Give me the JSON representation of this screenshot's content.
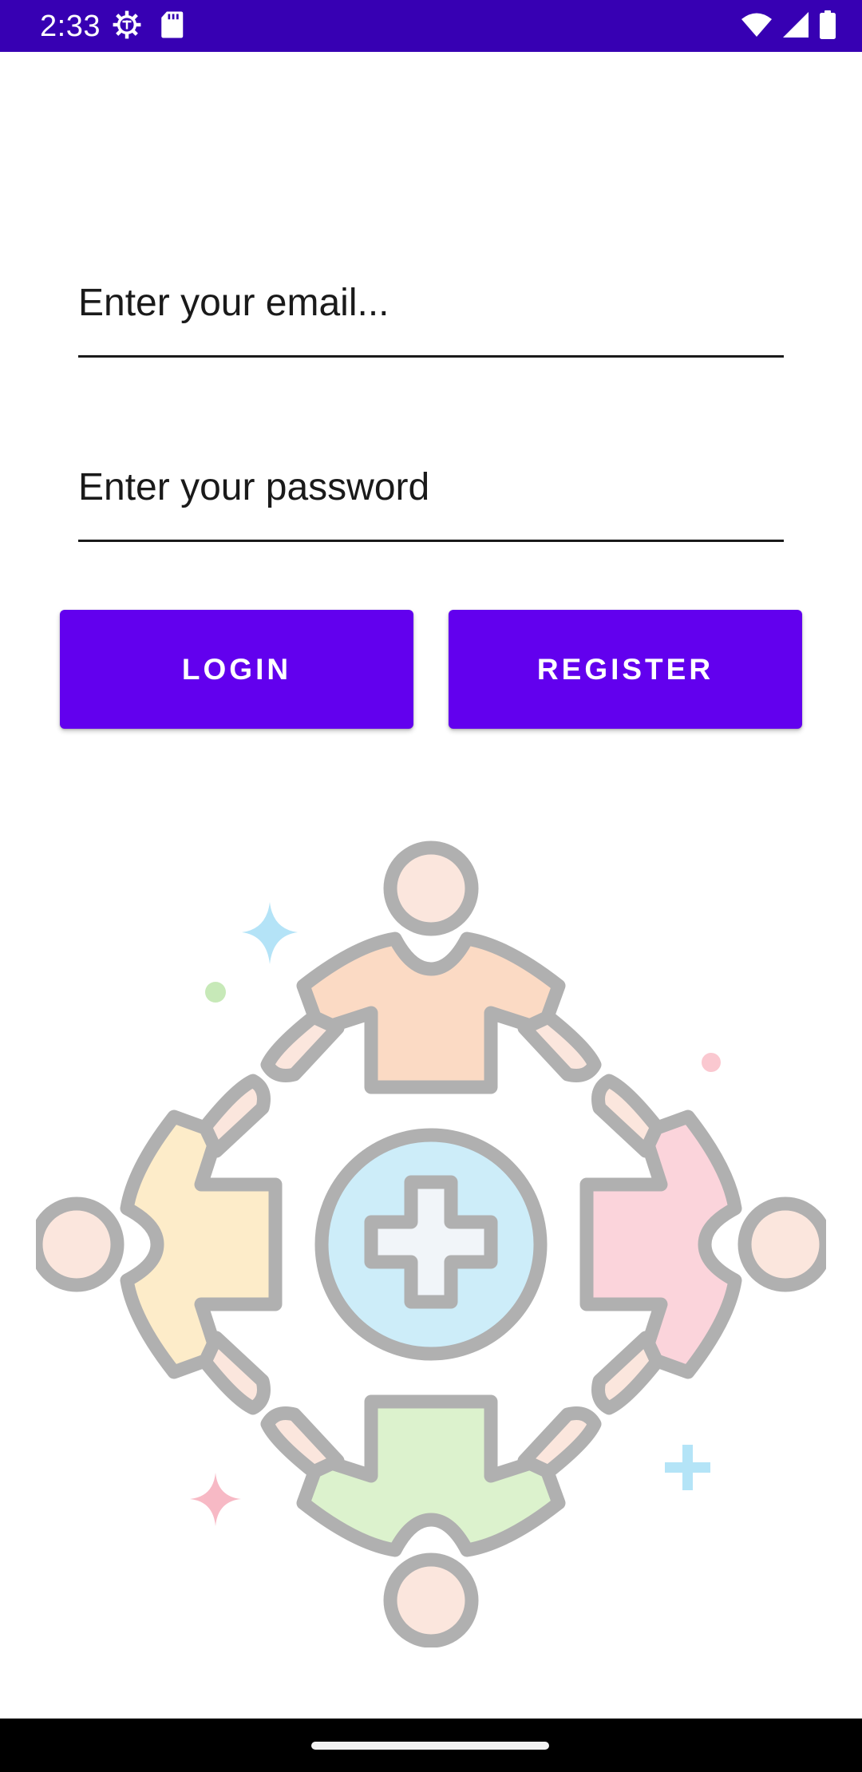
{
  "status_bar": {
    "time": "2:33",
    "background": "#3700b3",
    "left_icons": [
      "settings-gear-icon",
      "sd-card-icon"
    ],
    "right_icons": [
      "wifi-icon",
      "cellular-signal-icon",
      "battery-icon"
    ]
  },
  "form": {
    "email_placeholder": "Enter your email...",
    "email_value": "",
    "password_placeholder": "Enter your password",
    "password_value": ""
  },
  "buttons": {
    "login_label": "LOGIN",
    "register_label": "REGISTER",
    "color": "#6200ee"
  },
  "illustration": {
    "icon": "community-healthcare-icon"
  },
  "nav_bar": {
    "icon": "home-gesture-handle-icon"
  }
}
